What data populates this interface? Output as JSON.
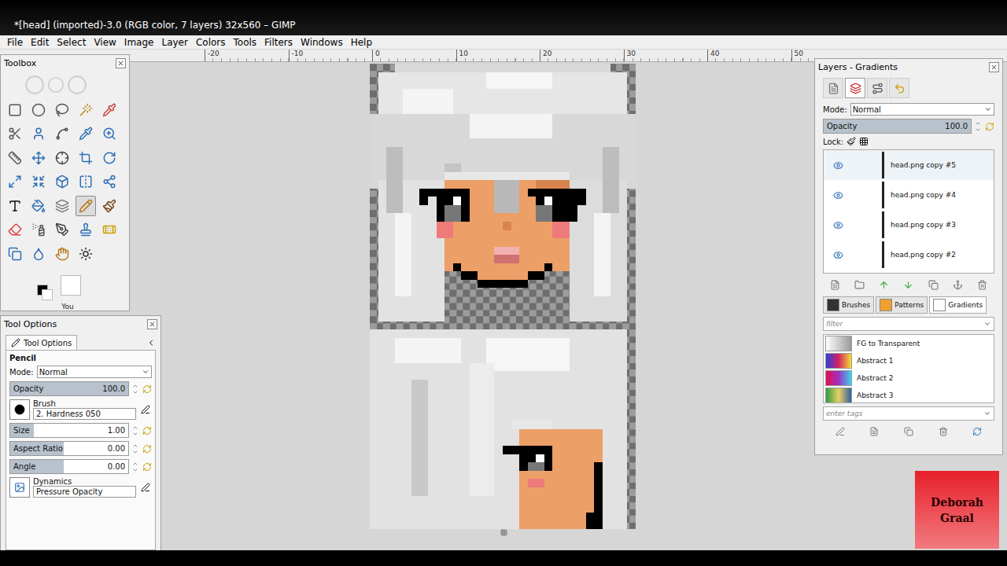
{
  "window": {
    "title": "*[head] (imported)-3.0 (RGB color, 7 layers) 32x560 – GIMP"
  },
  "menu": [
    "File",
    "Edit",
    "Select",
    "View",
    "Image",
    "Layer",
    "Colors",
    "Tools",
    "Filters",
    "Windows",
    "Help"
  ],
  "ruler": [
    "-20",
    "-10",
    "0",
    "10",
    "20",
    "30",
    "40",
    "50"
  ],
  "toolbox": {
    "title": "Toolbox",
    "label": "You",
    "tools": [
      {
        "selected": false
      },
      {
        "selected": false
      },
      {
        "selected": false
      },
      {
        "selected": false
      },
      {
        "selected": false
      },
      {
        "selected": false
      },
      {
        "selected": false
      },
      {
        "selected": false
      },
      {
        "selected": false
      },
      {
        "selected": false
      },
      {
        "selected": false
      },
      {
        "selected": false
      },
      {
        "selected": false
      },
      {
        "selected": false
      },
      {
        "selected": false
      },
      {
        "selected": false
      },
      {
        "selected": false
      },
      {
        "selected": false
      },
      {
        "selected": false
      },
      {
        "selected": false
      },
      {
        "selected": false
      },
      {
        "selected": false
      },
      {
        "selected": false
      },
      {
        "selected": true
      },
      {
        "selected": false
      },
      {
        "selected": false
      },
      {
        "selected": false
      },
      {
        "selected": false
      },
      {
        "selected": false
      },
      {
        "selected": false
      },
      {
        "selected": false
      },
      {
        "selected": false
      },
      {
        "selected": false
      },
      {
        "selected": false
      }
    ]
  },
  "tool_options": {
    "title": "Tool Options",
    "tab": "Tool Options",
    "tool": "Pencil",
    "mode_label": "Mode:",
    "mode": "Normal",
    "sliders": [
      {
        "label": "Opacity",
        "value": "100.0",
        "level": 1.0
      }
    ],
    "brush_label": "Brush",
    "brush": "2. Hardness 050",
    "scales": [
      {
        "label": "Size",
        "value": "1.00",
        "level": 0.2
      },
      {
        "label": "Aspect Ratio",
        "value": "0.00",
        "level": 0.45
      },
      {
        "label": "Angle",
        "value": "0.00",
        "level": 0.45
      }
    ],
    "dynamics_label": "Dynamics",
    "dynamics": "Pressure Opacity"
  },
  "layers_dock": {
    "title": "Layers - Gradients",
    "dock_tabs": [
      {
        "selected": false
      },
      {
        "selected": true
      },
      {
        "selected": false
      },
      {
        "selected": false
      }
    ],
    "mode_label": "Mode:",
    "mode": "Normal",
    "opacity_label": "Opacity",
    "opacity": "100.0",
    "opacity_level": 1.0,
    "lock_label": "Lock:",
    "layers": [
      {
        "name": "head.png copy #5",
        "visible": true,
        "selected": true
      },
      {
        "name": "head.png copy #4",
        "visible": true,
        "selected": false
      },
      {
        "name": "head.png copy #3",
        "visible": true,
        "selected": false
      },
      {
        "name": "head.png copy #2",
        "visible": true,
        "selected": false
      }
    ],
    "tabs": [
      {
        "label": "Brushes",
        "selected": false
      },
      {
        "label": "Patterns",
        "selected": false
      },
      {
        "label": "Gradients",
        "selected": true
      }
    ],
    "filter_placeholder": "filter",
    "gradients": [
      {
        "name": "FG to Transparent",
        "colors": [
          "#ffffff",
          "#9a9a9a"
        ]
      },
      {
        "name": "Abstract 1",
        "colors": [
          "#2a3fd8",
          "#d82060",
          "#f2e030"
        ]
      },
      {
        "name": "Abstract 2",
        "colors": [
          "#e01050",
          "#a030c0",
          "#30d8f0"
        ]
      },
      {
        "name": "Abstract 3",
        "colors": [
          "#2f9a40",
          "#e8d060",
          "#2f5fa0"
        ]
      }
    ],
    "tags_placeholder": "enter tags"
  },
  "watermark": [
    "Deborah",
    "Graal"
  ]
}
